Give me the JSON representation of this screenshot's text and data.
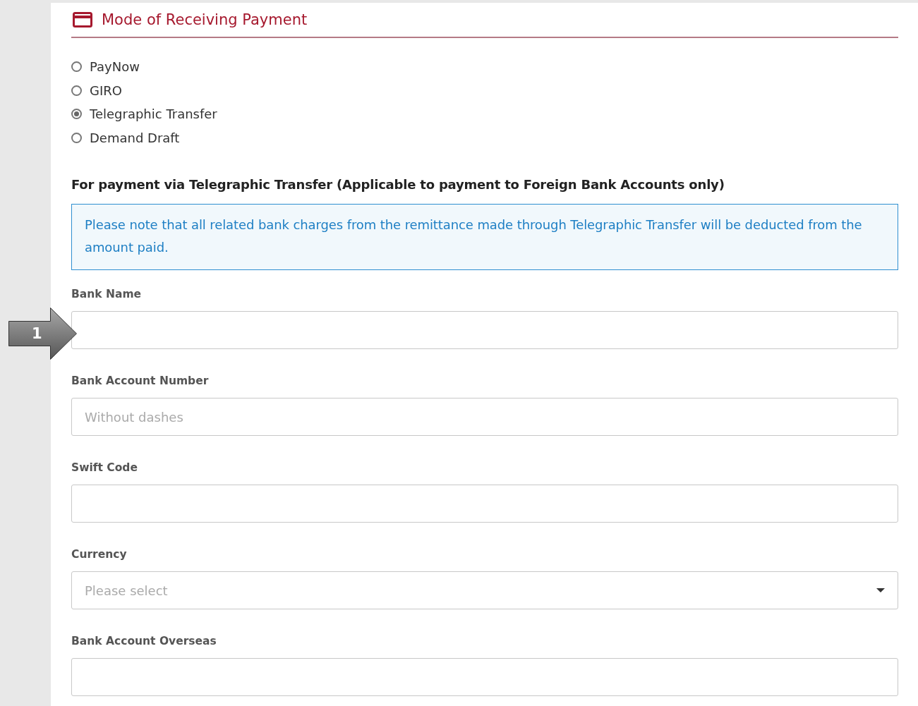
{
  "section": {
    "title": "Mode of Receiving Payment"
  },
  "payment_modes": [
    {
      "label": "PayNow",
      "selected": false
    },
    {
      "label": "GIRO",
      "selected": false
    },
    {
      "label": "Telegraphic Transfer",
      "selected": true
    },
    {
      "label": "Demand Draft",
      "selected": false
    }
  ],
  "subheading": "For payment via Telegraphic Transfer (Applicable to payment to Foreign Bank Accounts only)",
  "notice": "Please note that all related bank charges from the remittance made through Telegraphic Transfer will be deducted from the amount paid.",
  "fields": [
    {
      "kind": "text",
      "label": "Bank Name"
    },
    {
      "kind": "text",
      "label": "Bank Account Number",
      "placeholder": "Without dashes"
    },
    {
      "kind": "text",
      "label": "Swift Code"
    },
    {
      "kind": "select",
      "label": "Currency",
      "placeholder": "Please select"
    },
    {
      "kind": "text",
      "label": "Bank Account Overseas"
    }
  ],
  "callout": {
    "number": "1"
  }
}
